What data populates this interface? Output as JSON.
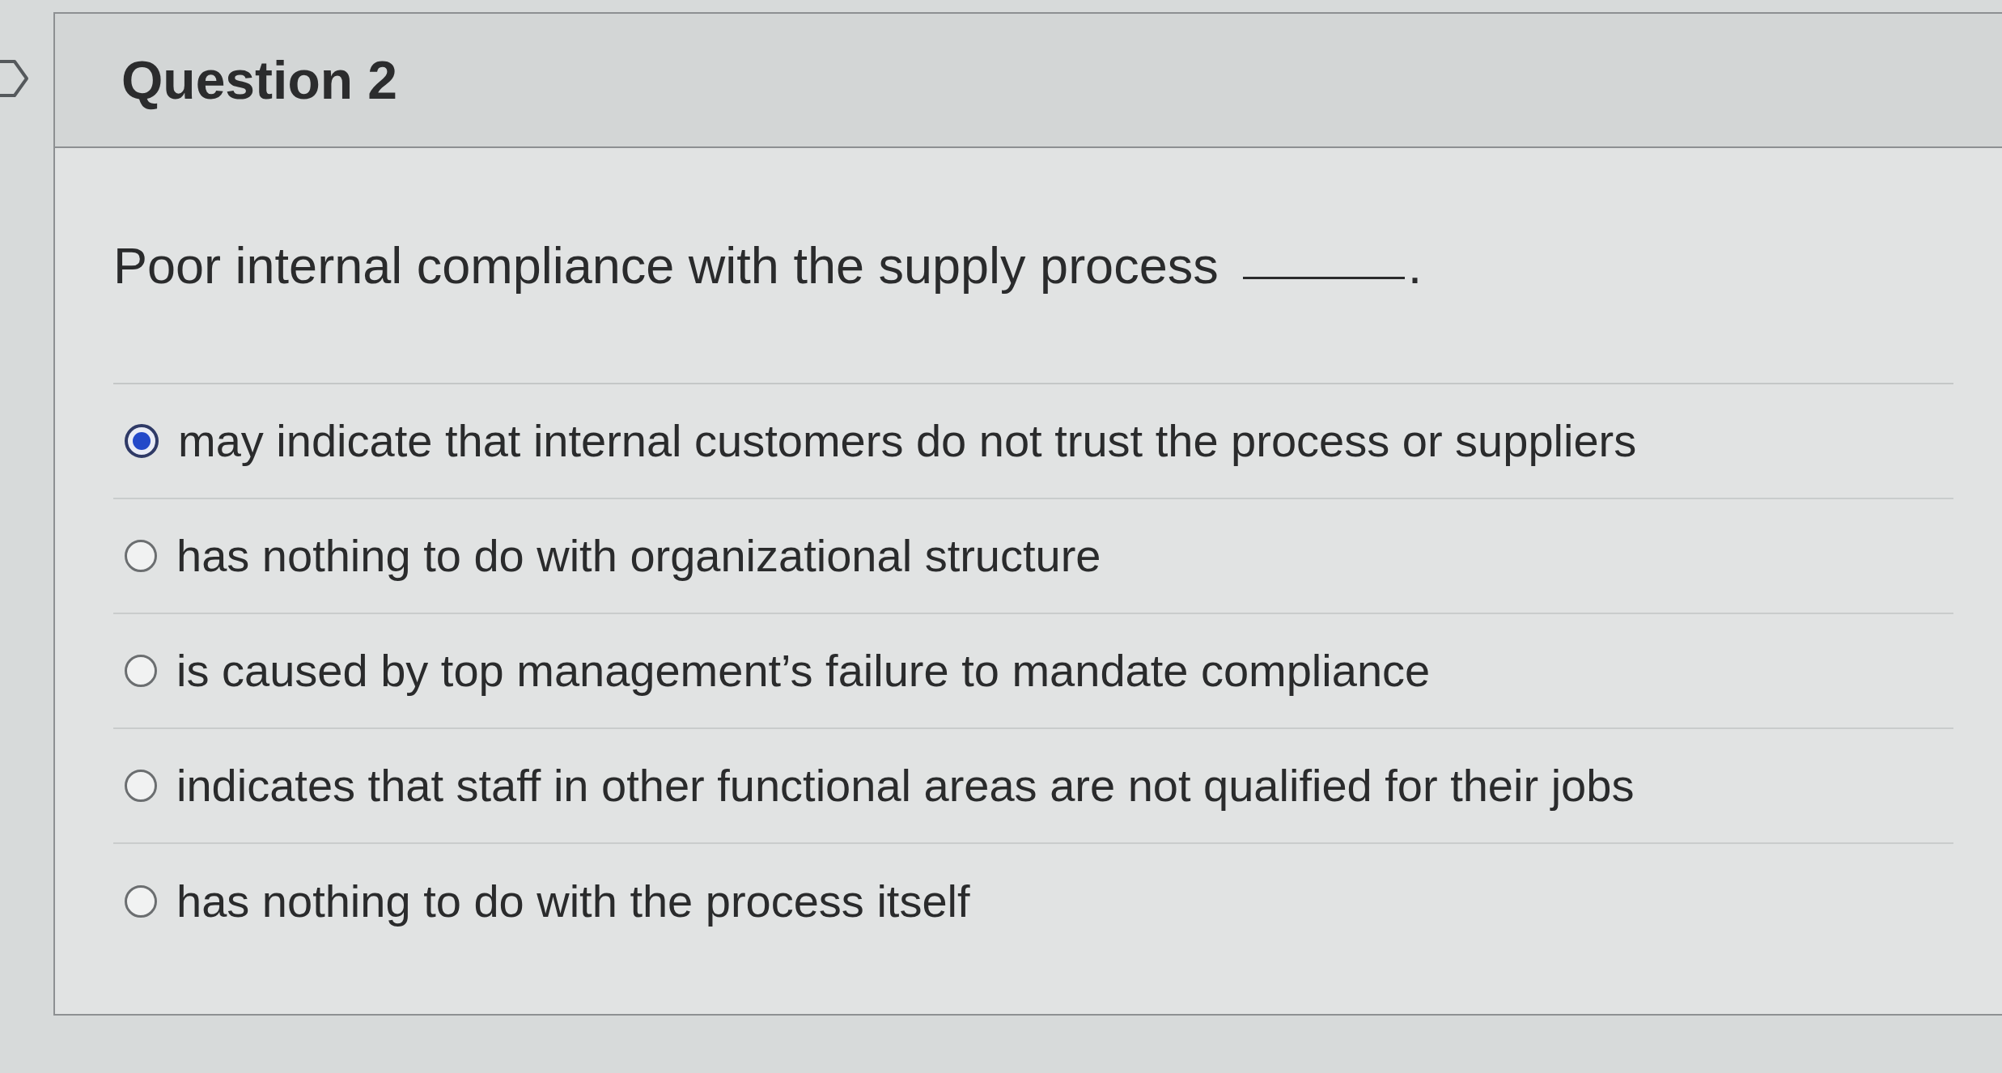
{
  "question": {
    "title": "Question 2",
    "prompt": "Poor internal compliance with the supply process",
    "suffix": "."
  },
  "options": [
    {
      "label": "may indicate that internal customers do not trust the process or suppliers",
      "selected": true
    },
    {
      "label": "has nothing to do with organizational structure",
      "selected": false
    },
    {
      "label": "is caused by top management’s failure to mandate compliance",
      "selected": false
    },
    {
      "label": "indicates that staff in other functional areas are not qualified for their jobs",
      "selected": false
    },
    {
      "label": "has nothing to do with the process itself",
      "selected": false
    }
  ]
}
